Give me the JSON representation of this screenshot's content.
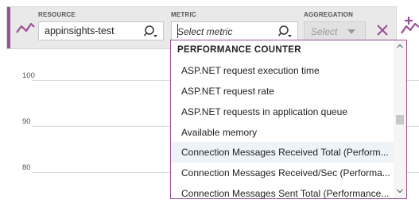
{
  "toolbar": {
    "resource_label": "RESOURCE",
    "resource_value": "appinsights-test",
    "metric_label": "METRIC",
    "metric_placeholder": "Select metric",
    "aggregation_label": "AGGREGATION",
    "aggregation_placeholder": "Select"
  },
  "chart": {
    "yticks": [
      "100",
      "90",
      "80"
    ]
  },
  "dropdown": {
    "header": "PERFORMANCE COUNTER",
    "items": [
      "ASP.NET request execution time",
      "ASP.NET request rate",
      "ASP.NET requests in application queue",
      "Available memory",
      "Connection Messages Received Total (Perform...",
      "Connection Messages Received/Sec (Performa...",
      "Connection Messages Sent Total (Performance..."
    ],
    "highlighted_index": 4
  },
  "colors": {
    "accent": "#9b4f96",
    "toolbar_bg": "#e9e9e9",
    "highlight_bg": "#eef3f8"
  }
}
